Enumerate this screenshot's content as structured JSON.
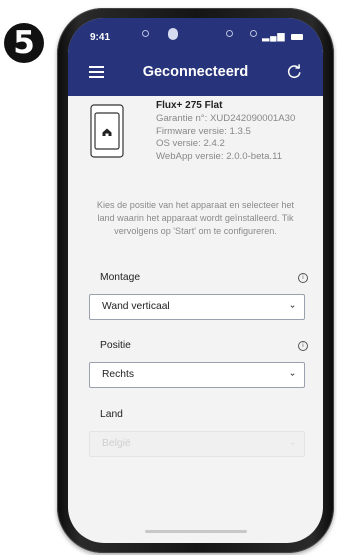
{
  "step_number": "5",
  "status_bar": {
    "time": "9:41"
  },
  "header": {
    "title": "Geconnecteerd"
  },
  "device": {
    "name": "Flux+ 275 Flat",
    "warranty": "Garantie n°: XUD242090001A30",
    "firmware": "Firmware versie: 1.3.5",
    "os": "OS versie: 2.4.2",
    "webapp": "WebApp versie: 2.0.0-beta.11"
  },
  "instruction": "Kies de positie van het apparaat en selecteer het land waarin het apparaat wordt geïnstalleerd. Tik vervolgens op 'Start' om te configureren.",
  "fields": {
    "montage": {
      "label": "Montage",
      "value": "Wand verticaal"
    },
    "positie": {
      "label": "Positie",
      "value": "Rechts"
    },
    "land": {
      "label": "Land",
      "value": "België"
    }
  },
  "icons": {
    "menu": "hamburger-menu-icon",
    "refresh": "refresh-icon",
    "info": "info-icon",
    "chevron": "chevron-down-icon"
  },
  "colors": {
    "header": "#27337a",
    "background": "#f3f3f3"
  }
}
